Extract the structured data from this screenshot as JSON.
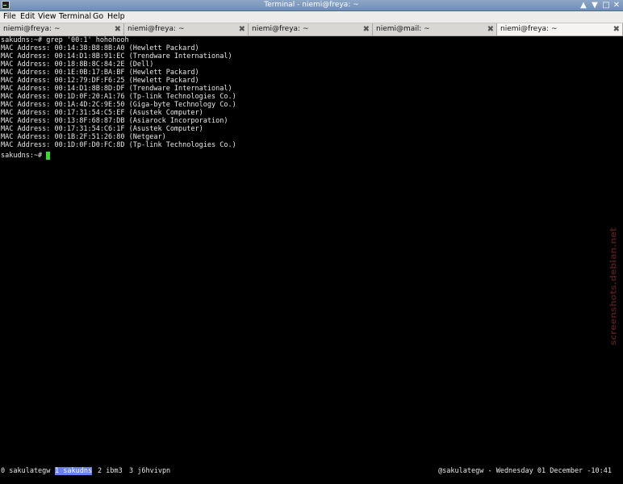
{
  "window": {
    "title": "Terminal - niemi@freya: ~",
    "buttons": [
      "▲",
      "▼",
      "□",
      "✕"
    ]
  },
  "menubar": [
    "File",
    "Edit",
    "View",
    "Terminal",
    "Go",
    "Help"
  ],
  "tabs": [
    {
      "label": "niemi@freya: ~",
      "close": "✖",
      "active": false
    },
    {
      "label": "niemi@freya: ~",
      "close": "✖",
      "active": false
    },
    {
      "label": "niemi@freya: ~",
      "close": "✖",
      "active": false
    },
    {
      "label": "niemi@mail: ~",
      "close": "✖",
      "active": false
    },
    {
      "label": "niemi@freya: ~",
      "close": "✖",
      "active": true
    }
  ],
  "terminal": {
    "lines": [
      "sakudns:~# grep '00:1' hohohooh",
      "MAC Address: 00:14:38:B8:8B:A0 (Hewlett Packard)",
      "MAC Address: 00:14:D1:8B:91:EC (Trendware International)",
      "MAC Address: 00:18:8B:8C:84:2E (Dell)",
      "MAC Address: 00:1E:0B:17:BA:BF (Hewlett Packard)",
      "MAC Address: 00:12:79:DF:F6:25 (Hewlett Packard)",
      "MAC Address: 00:14:D1:8B:8D:DF (Trendware International)",
      "MAC Address: 00:1D:0F:20:A1:76 (Tp-link Technologies Co.)",
      "MAC Address: 00:1A:4D:2C:9E:50 (Giga-byte Technology Co.)",
      "MAC Address: 00:17:31:54:C5:EF (Asustek Computer)",
      "MAC Address: 00:13:8F:68:87:DB (Asiarock Incorporation)",
      "MAC Address: 00:17:31:54:C6:1F (Asustek Computer)",
      "MAC Address: 00:1B:2F:51:26:80 (Netgear)",
      "MAC Address: 00:1D:0F:D0:FC:8D (Tp-link Technologies Co.)"
    ],
    "prompt": "sakudns:~# "
  },
  "statusbar": {
    "windows": [
      {
        "label": "0 sakulategw",
        "active": false
      },
      {
        "label": "1 sakudns",
        "active": true
      },
      {
        "label": "2 ibm3",
        "active": false
      },
      {
        "label": "3 j6hvivpn",
        "active": false
      }
    ],
    "right": "@sakulategw - Wednesday 01 December -10:41"
  },
  "watermark": "screenshots.debian.net",
  "colors": {
    "cursor": "#2fe02f",
    "active_window": "#6a7ff0",
    "titlebar": "#7a97bd"
  }
}
